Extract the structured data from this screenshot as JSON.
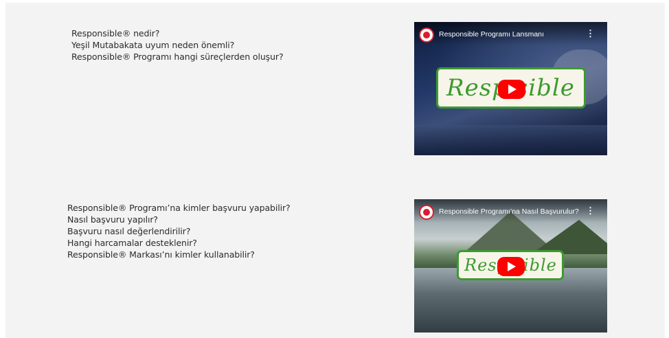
{
  "section1": {
    "questions": [
      "Responsible® nedir?",
      "Yeşil Mutabakata uyum neden önemli?",
      "Responsible® Programı hangi süreçlerden oluşur?"
    ],
    "video": {
      "title": "Responsible Programı Lansmanı",
      "menu": "⋮",
      "logo_text": "Resp  sible",
      "icon": "youtube-play-icon"
    }
  },
  "section2": {
    "questions": [
      "Responsible® Programı’na kimler başvuru yapabilir?",
      "Nasıl başvuru yapılır?",
      "Başvuru nasıl değerlendirilir?",
      "Hangi harcamalar desteklenir?",
      "Responsible® Markası’nı kimler kullanabilir?"
    ],
    "video": {
      "title": "Responsible Programı’na Nasıl Başvurulur?",
      "menu": "⋮",
      "logo_text": "Resp  sible",
      "icon": "youtube-play-icon"
    }
  },
  "colors": {
    "panel_bg": "#f3f3f3",
    "text": "#2b2b2b",
    "brand_green": "#3d9a2f",
    "youtube_red": "#ff0000"
  }
}
